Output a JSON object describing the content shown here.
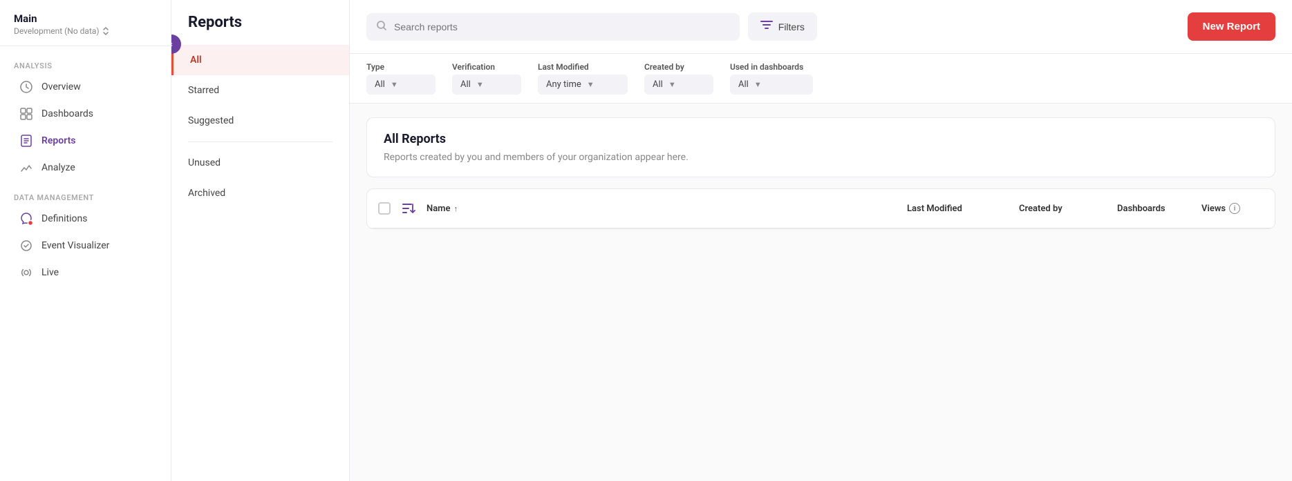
{
  "app": {
    "name": "Main",
    "subtitle": "Development (No data)",
    "collapse_icon": "‹"
  },
  "sidebar": {
    "sections": [
      {
        "label": "Analysis",
        "items": [
          {
            "id": "overview",
            "label": "Overview",
            "icon": "overview"
          },
          {
            "id": "dashboards",
            "label": "Dashboards",
            "icon": "dashboards"
          },
          {
            "id": "reports",
            "label": "Reports",
            "icon": "reports",
            "active": true
          },
          {
            "id": "analyze",
            "label": "Analyze",
            "icon": "analyze"
          }
        ]
      },
      {
        "label": "Data Management",
        "items": [
          {
            "id": "definitions",
            "label": "Definitions",
            "icon": "definitions",
            "badge": true
          },
          {
            "id": "event-visualizer",
            "label": "Event Visualizer",
            "icon": "event-visualizer"
          },
          {
            "id": "live",
            "label": "Live",
            "icon": "live"
          }
        ]
      }
    ]
  },
  "reports_page": {
    "title": "Reports",
    "nav_items": [
      {
        "id": "all",
        "label": "All",
        "active": true
      },
      {
        "id": "starred",
        "label": "Starred"
      },
      {
        "id": "suggested",
        "label": "Suggested"
      },
      {
        "id": "unused",
        "label": "Unused"
      },
      {
        "id": "archived",
        "label": "Archived"
      }
    ]
  },
  "header": {
    "search_placeholder": "Search reports",
    "filters_label": "Filters",
    "new_report_label": "New Report"
  },
  "filters": {
    "type": {
      "label": "Type",
      "value": "All"
    },
    "verification": {
      "label": "Verification",
      "value": "All"
    },
    "last_modified": {
      "label": "Last Modified",
      "value": "Any time"
    },
    "created_by": {
      "label": "Created by",
      "value": "All"
    },
    "used_in_dashboards": {
      "label": "Used in dashboards",
      "value": "All"
    }
  },
  "all_reports": {
    "title": "All Reports",
    "description": "Reports created by you and members of your organization appear here."
  },
  "table": {
    "columns": {
      "name": "Name",
      "name_sort": "↑",
      "last_modified": "Last Modified",
      "created_by": "Created by",
      "dashboards": "Dashboards",
      "views": "Views"
    }
  }
}
